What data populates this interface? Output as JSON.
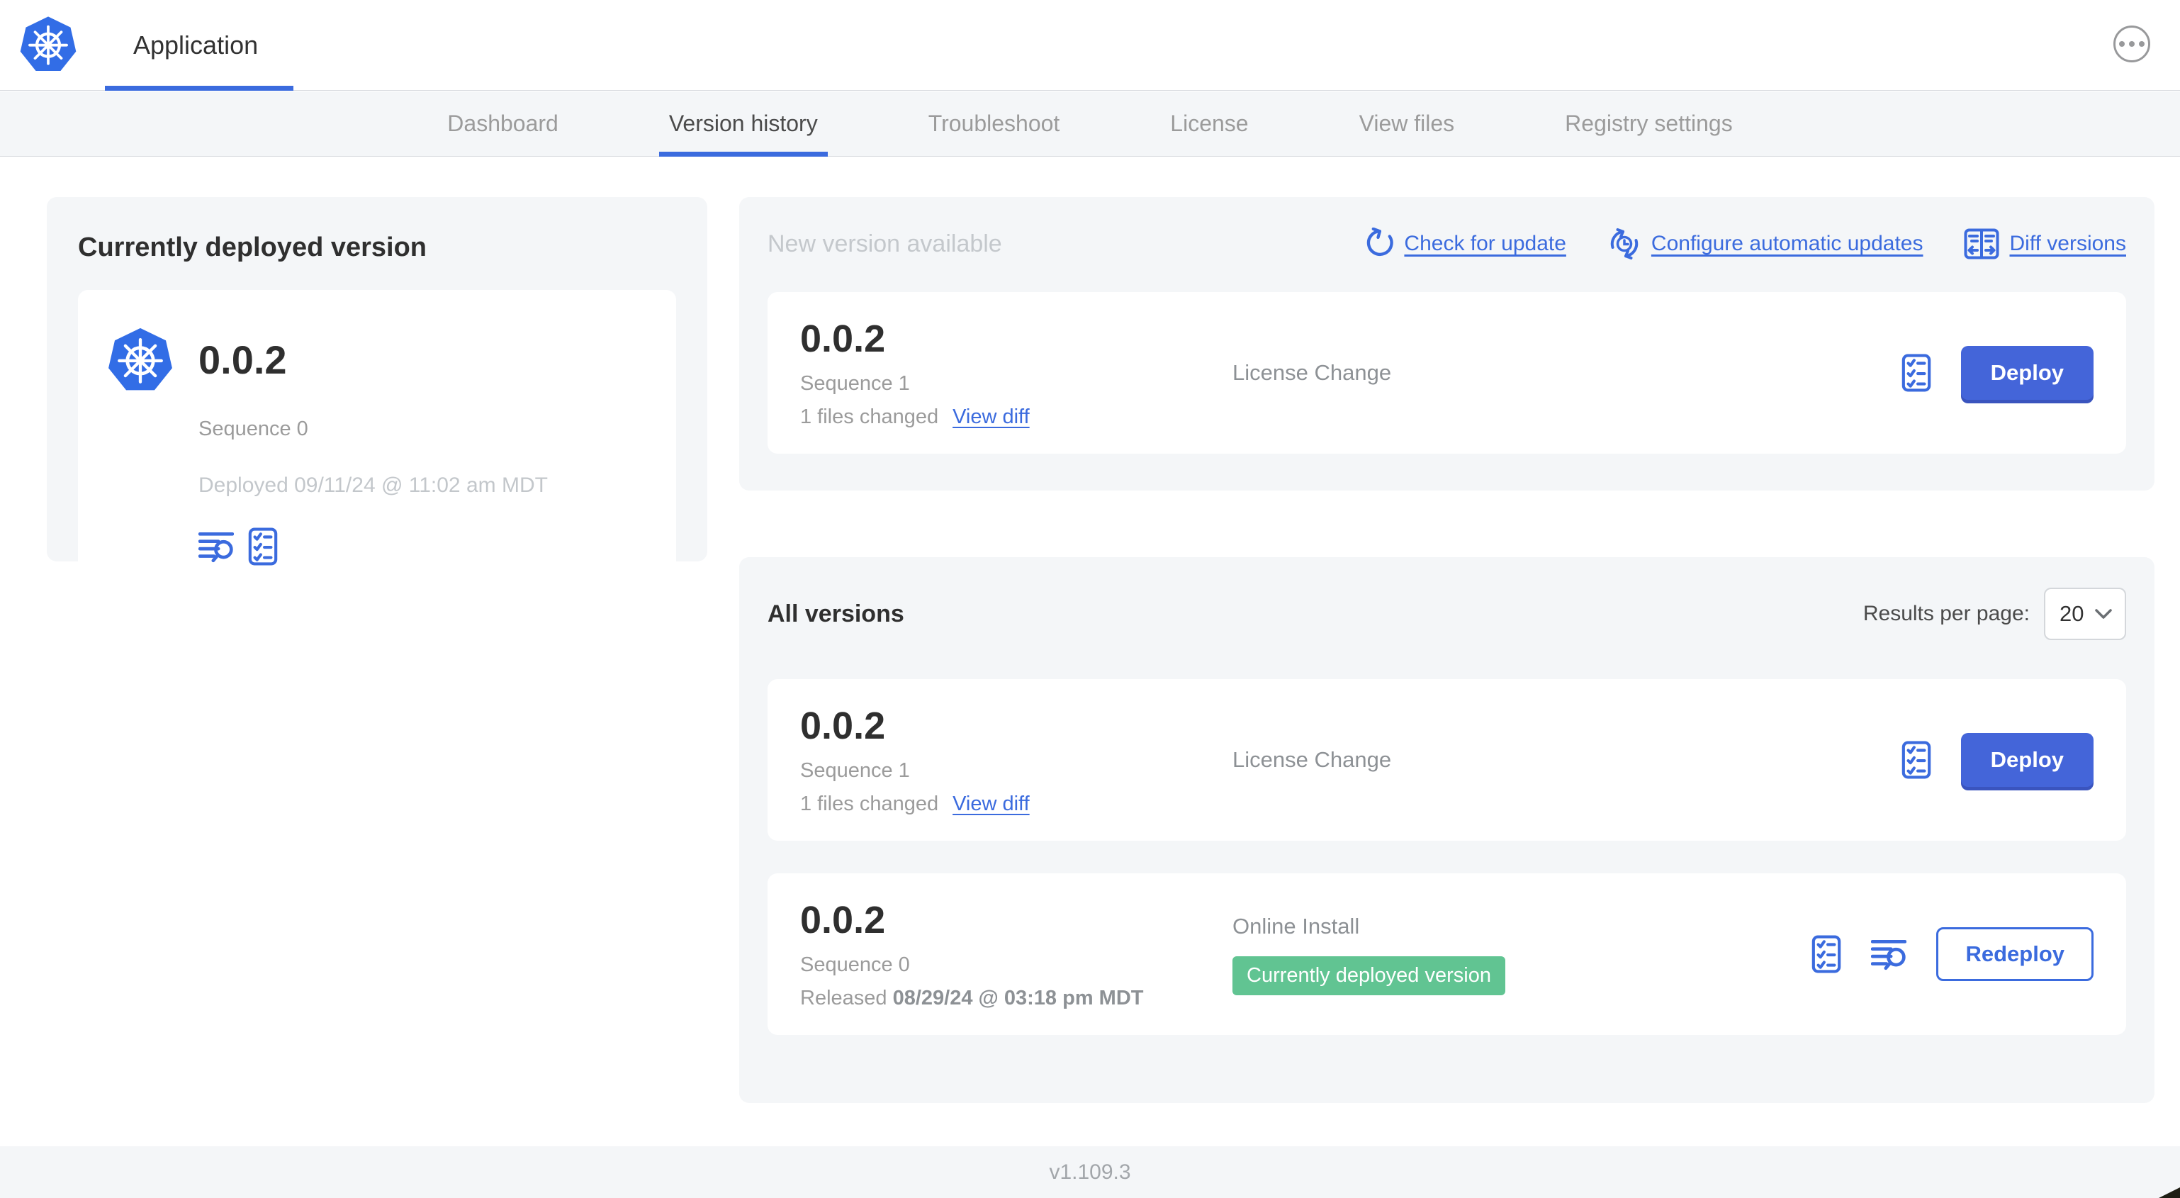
{
  "colors": {
    "accent_blue": "#3b6bde",
    "button_blue": "#4465d9",
    "badge_green": "#61c492",
    "card_background": "#f4f6f8",
    "kubernetes_blue": "#326de6"
  },
  "header": {
    "app_title": "Application",
    "menu_icon": "ellipsis-icon",
    "logo_icon": "kubernetes-logo-icon"
  },
  "tabs": [
    {
      "label": "Dashboard",
      "active": false
    },
    {
      "label": "Version history",
      "active": true
    },
    {
      "label": "Troubleshoot",
      "active": false
    },
    {
      "label": "License",
      "active": false
    },
    {
      "label": "View files",
      "active": false
    },
    {
      "label": "Registry settings",
      "active": false
    }
  ],
  "current_version_panel": {
    "title": "Currently deployed version",
    "version": "0.0.2",
    "sequence": "Sequence 0",
    "deployed": "Deployed 09/11/24 @ 11:02 am MDT",
    "icons": [
      "view-logs-icon",
      "view-config-icon"
    ]
  },
  "new_version_section": {
    "title": "New version available",
    "actions": [
      {
        "label": "Check for update",
        "icon": "refresh-icon"
      },
      {
        "label": "Configure automatic updates",
        "icon": "schedule-update-icon"
      },
      {
        "label": "Diff versions",
        "icon": "diff-icon"
      }
    ],
    "card": {
      "version": "0.0.2",
      "sequence": "Sequence 1",
      "files_changed": "1 files changed",
      "view_diff_label": "View diff",
      "source": "License Change",
      "action_label": "Deploy",
      "icons": [
        "view-config-icon"
      ]
    }
  },
  "all_versions_section": {
    "title": "All versions",
    "results_per_page_label": "Results per page:",
    "results_per_page_value": "20",
    "rows": [
      {
        "version": "0.0.2",
        "sequence": "Sequence 1",
        "files_changed": "1 files changed",
        "view_diff_label": "View diff",
        "source": "License Change",
        "action_label": "Deploy",
        "icons": [
          "view-config-icon"
        ]
      },
      {
        "version": "0.0.2",
        "sequence": "Sequence 0",
        "released_label": "Released",
        "released_date": "08/29/24 @ 03:18 pm MDT",
        "source": "Online Install",
        "badge": "Currently deployed version",
        "action_label": "Redeploy",
        "icons": [
          "view-config-icon",
          "view-logs-icon"
        ]
      }
    ]
  },
  "footer": {
    "app_version": "v1.109.3"
  }
}
